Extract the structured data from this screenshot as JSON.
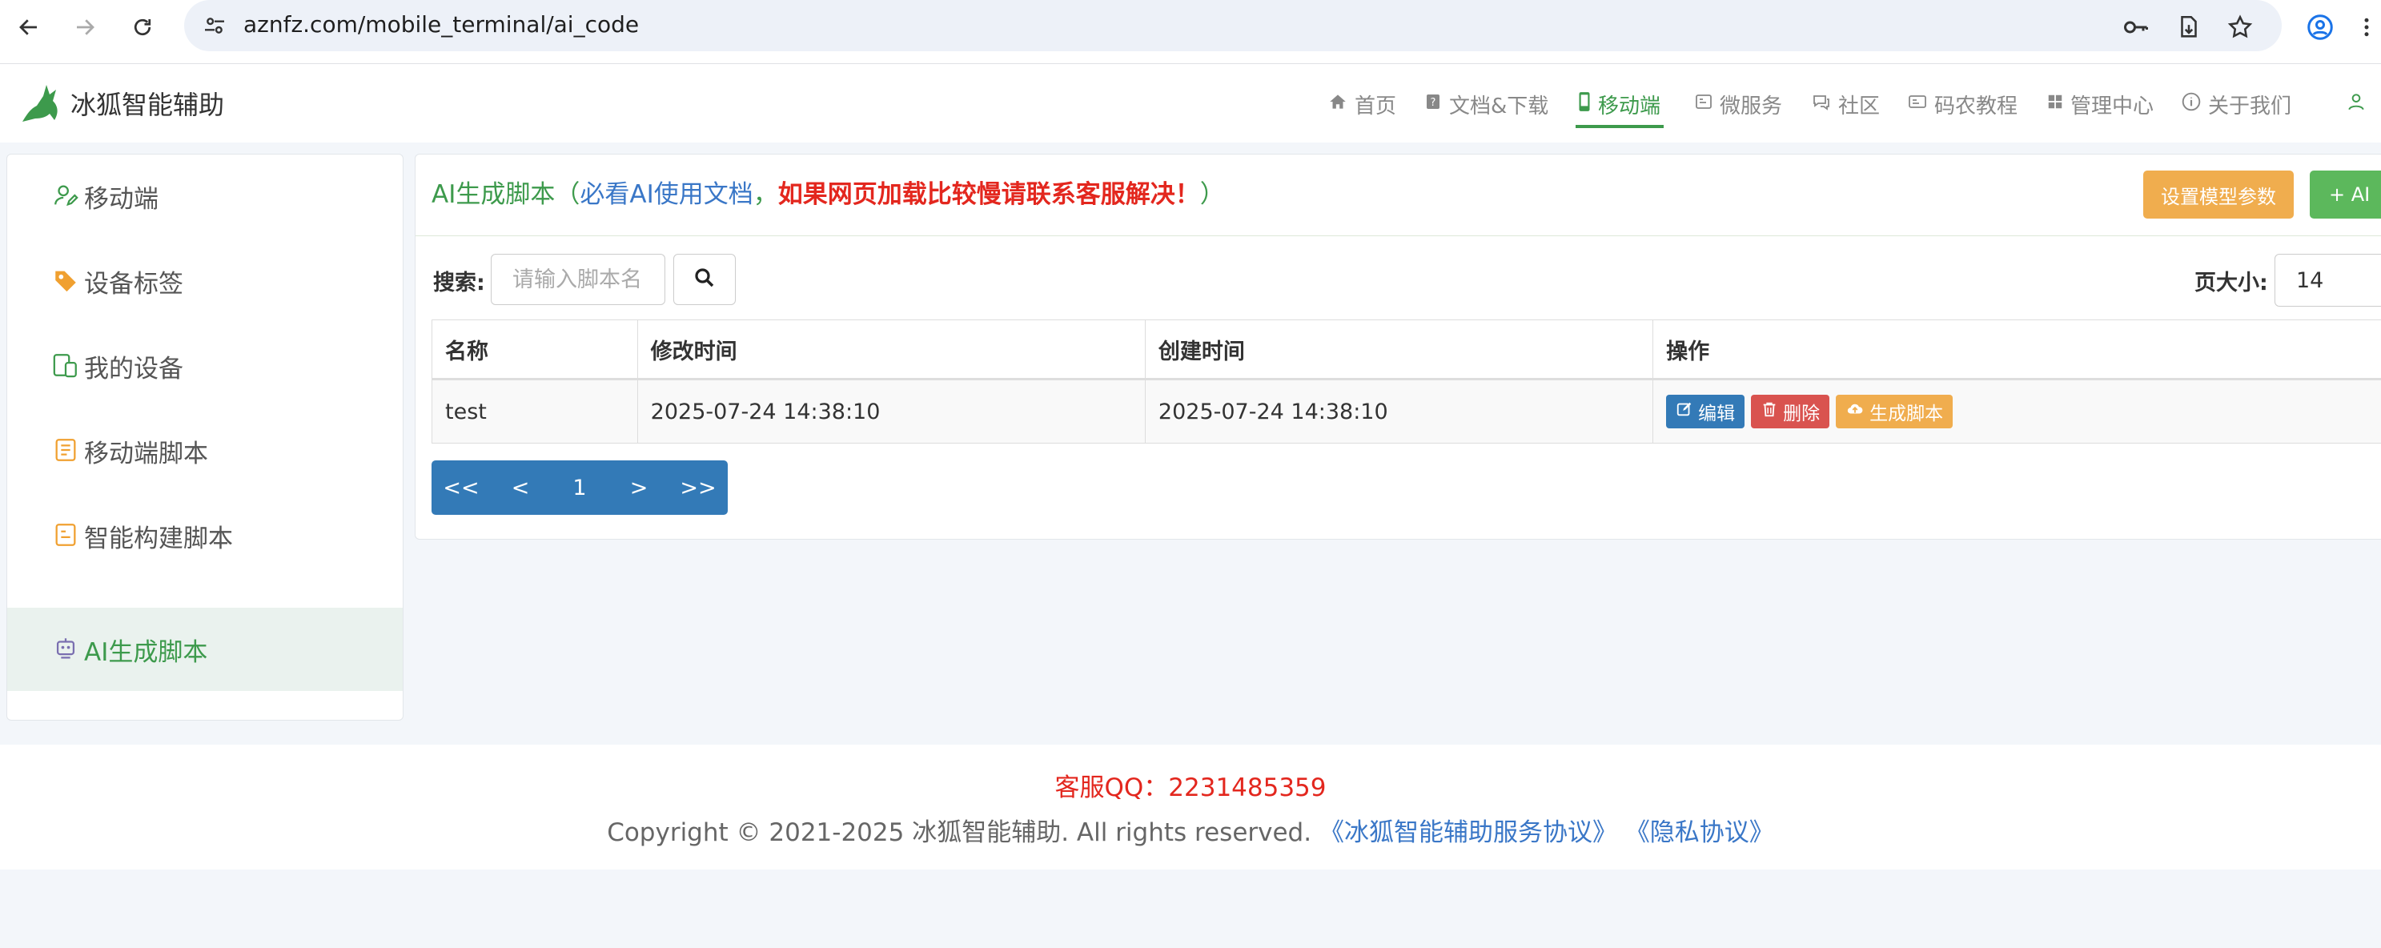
{
  "browser": {
    "url": "aznfz.com/mobile_terminal/ai_code"
  },
  "header": {
    "logo_text": "冰狐智能辅助",
    "nav": [
      {
        "label": "首页",
        "icon": "home-icon"
      },
      {
        "label": "文档&下载",
        "icon": "doc-icon"
      },
      {
        "label": "移动端",
        "icon": "mobile-icon",
        "active": true
      },
      {
        "label": "微服务",
        "icon": "server-icon"
      },
      {
        "label": "社区",
        "icon": "chat-icon"
      },
      {
        "label": "码农教程",
        "icon": "card-icon"
      },
      {
        "label": "管理中心",
        "icon": "grid-icon"
      },
      {
        "label": "关于我们",
        "icon": "info-icon"
      }
    ]
  },
  "sidebar": {
    "items": [
      {
        "label": "移动端",
        "icon": "user-edit-icon"
      },
      {
        "label": "设备标签",
        "icon": "tag-icon"
      },
      {
        "label": "我的设备",
        "icon": "devices-icon"
      },
      {
        "label": "移动端脚本",
        "icon": "script-icon"
      },
      {
        "label": "智能构建脚本",
        "icon": "build-icon"
      },
      {
        "label": "AI生成脚本",
        "icon": "robot-icon",
        "active": true
      }
    ]
  },
  "main": {
    "title_prefix": "AI生成脚本（",
    "title_link": "必看AI使用文档",
    "title_sep": "，",
    "title_warning": "如果网页加载比较慢请联系客服解决！",
    "title_suffix": "）",
    "model_button": "设置模型参数",
    "ai_button": "+ AI",
    "search_label": "搜索:",
    "search_placeholder": "请输入脚本名",
    "pagesize_label": "页大小:",
    "pagesize_value": "14",
    "table": {
      "headers": [
        "名称",
        "修改时间",
        "创建时间",
        "操作"
      ],
      "rows": [
        {
          "name": "test",
          "modified": "2025-07-24 14:38:10",
          "created": "2025-07-24 14:38:10"
        }
      ],
      "actions": {
        "edit": "编辑",
        "delete": "删除",
        "generate": "生成脚本"
      }
    },
    "pager": {
      "first": "<<",
      "prev": "<",
      "page": "1",
      "next": ">",
      "last": ">>"
    }
  },
  "footer": {
    "qq": "客服QQ：2231485359",
    "copyright": "Copyright © 2021-2025 冰狐智能辅助. All rights reserved.",
    "link_terms": "《冰狐智能辅助服务协议》",
    "link_privacy": "《隐私协议》"
  },
  "colors": {
    "accent_green": "#3d9a4c",
    "link_blue": "#3a77c7",
    "warning_red": "#e3271e",
    "btn_orange": "#f0ad4e",
    "btn_blue": "#337ab7",
    "btn_red": "#d9534f"
  }
}
